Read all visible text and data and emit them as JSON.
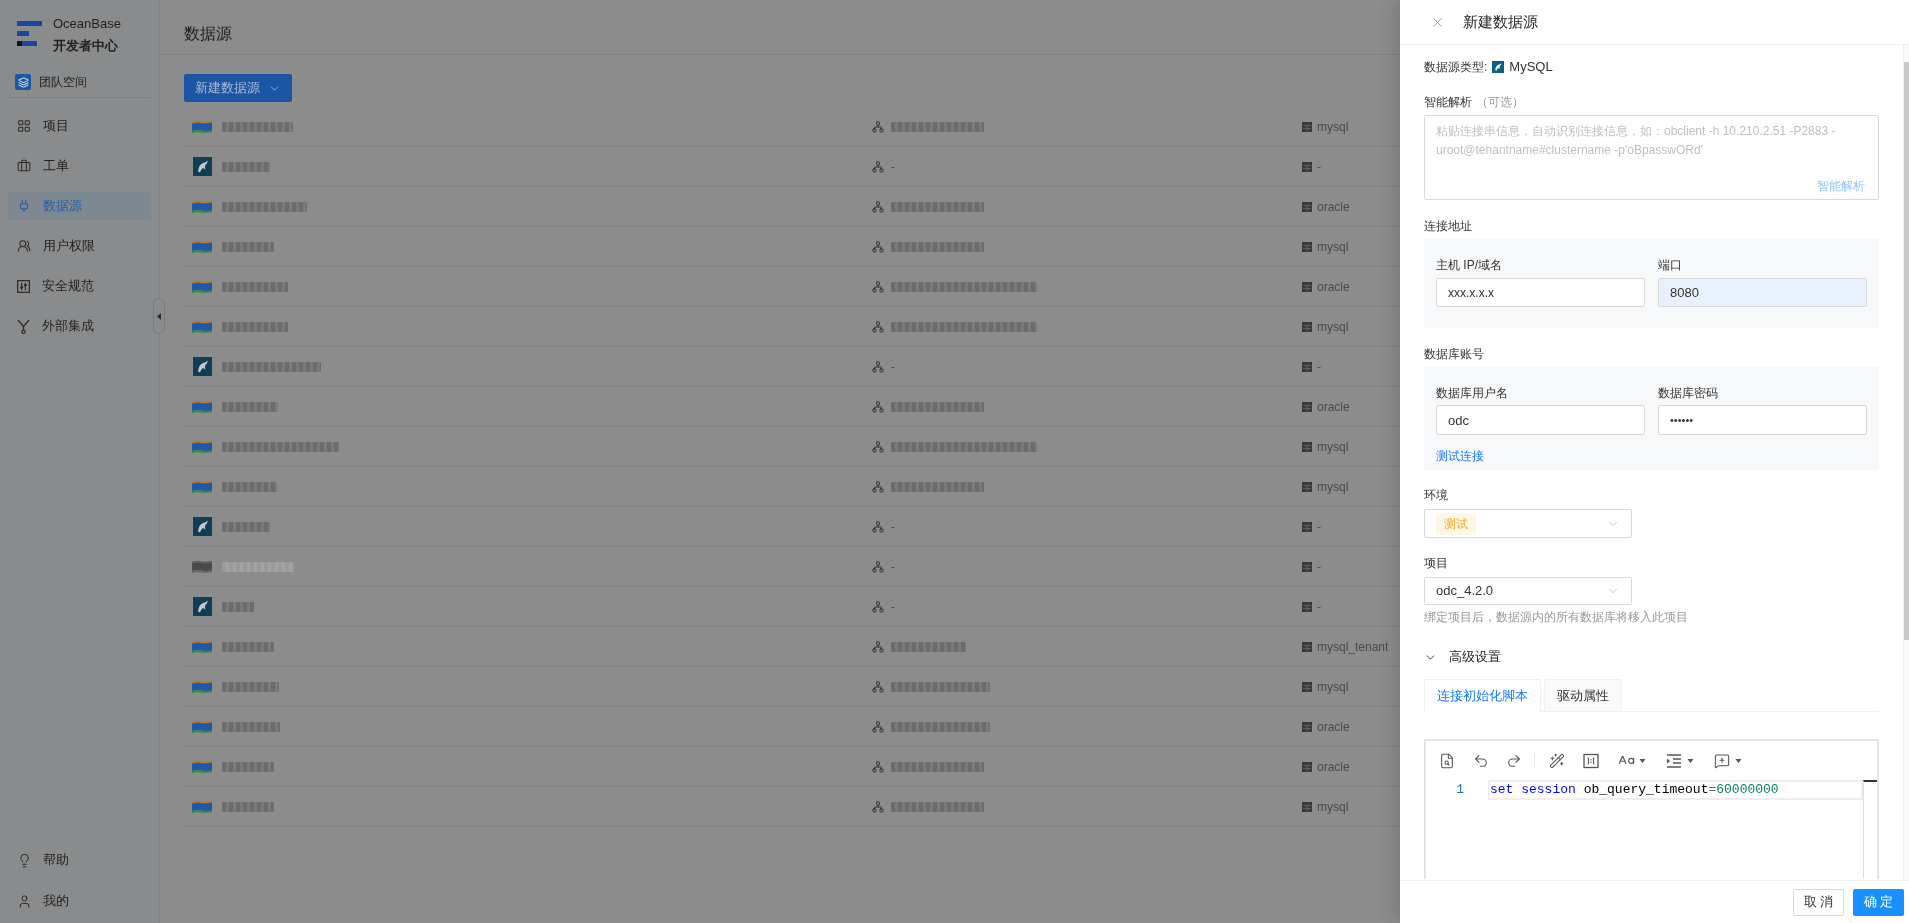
{
  "sidebar": {
    "brand": {
      "name": "OceanBase",
      "subtitle": "开发者中心"
    },
    "workspace": "团队空间",
    "nav": [
      {
        "label": "项目",
        "selected": false
      },
      {
        "label": "工单",
        "selected": false
      },
      {
        "label": "数据源",
        "selected": true
      },
      {
        "label": "用户权限",
        "selected": false
      },
      {
        "label": "安全规范",
        "selected": false
      },
      {
        "label": "外部集成",
        "selected": false
      }
    ],
    "footer": [
      {
        "label": "帮助"
      },
      {
        "label": "我的"
      }
    ]
  },
  "page": {
    "title": "数据源",
    "new_button": "新建数据源",
    "rows": [
      {
        "kind": "oceanbase",
        "disabled": false,
        "name_redacted": true,
        "host_redacted": true,
        "type": "mysql"
      },
      {
        "kind": "mysql",
        "disabled": false,
        "name_redacted": true,
        "host_redacted": false,
        "host": "-",
        "type": "-"
      },
      {
        "kind": "oceanbase",
        "disabled": false,
        "name_redacted": true,
        "host_redacted": true,
        "type": "oracle"
      },
      {
        "kind": "oceanbase",
        "disabled": false,
        "name_redacted": true,
        "host_redacted": true,
        "type": "mysql"
      },
      {
        "kind": "oceanbase",
        "disabled": false,
        "name_redacted": true,
        "host_redacted": true,
        "type": "oracle"
      },
      {
        "kind": "oceanbase",
        "disabled": false,
        "name_redacted": true,
        "host_redacted": true,
        "type": "mysql"
      },
      {
        "kind": "mysql",
        "disabled": false,
        "name_redacted": true,
        "host_redacted": false,
        "host": "-",
        "type": "-"
      },
      {
        "kind": "oceanbase",
        "disabled": false,
        "name_redacted": true,
        "host_redacted": true,
        "type": "oracle"
      },
      {
        "kind": "oceanbase",
        "disabled": false,
        "name_redacted": true,
        "host_redacted": true,
        "type": "mysql"
      },
      {
        "kind": "oceanbase",
        "disabled": false,
        "name_redacted": true,
        "host_redacted": true,
        "type": "mysql"
      },
      {
        "kind": "mysql",
        "disabled": false,
        "name_redacted": true,
        "host_redacted": false,
        "host": "-",
        "type": "-"
      },
      {
        "kind": "oceanbase",
        "disabled": true,
        "name_redacted": true,
        "host_redacted": false,
        "host": "-",
        "type": "-"
      },
      {
        "kind": "mysql",
        "disabled": false,
        "name_redacted": true,
        "host_redacted": false,
        "host": "-",
        "type": "-"
      },
      {
        "kind": "oceanbase",
        "disabled": false,
        "name_redacted": true,
        "host_redacted": true,
        "type": "mysql_tenant"
      },
      {
        "kind": "oceanbase",
        "disabled": false,
        "name_redacted": true,
        "host_redacted": true,
        "type": "mysql"
      },
      {
        "kind": "oceanbase",
        "disabled": false,
        "name_redacted": true,
        "host_redacted": true,
        "type": "oracle"
      },
      {
        "kind": "oceanbase",
        "disabled": false,
        "name_redacted": true,
        "host_redacted": true,
        "type": "oracle"
      },
      {
        "kind": "oceanbase",
        "disabled": false,
        "name_redacted": true,
        "host_redacted": true,
        "type": "mysql"
      }
    ]
  },
  "drawer": {
    "title": "新建数据源",
    "type": {
      "label": "数据源类型:",
      "value": "MySQL"
    },
    "smart_parse": {
      "label": "智能解析",
      "hint": "（可选）",
      "placeholder": "粘贴连接串信息，自动识别连接信息，如：obclient -h 10.210.2.51 -P2883 -uroot@tenantname#clustername -p'oBpasswORd'",
      "action": "智能解析"
    },
    "address": {
      "label": "连接地址",
      "host": {
        "label": "主机 IP/域名",
        "value": "xxx.x.x.x"
      },
      "port": {
        "label": "端口",
        "value": "8080",
        "autofilled": true
      }
    },
    "account": {
      "label": "数据库账号",
      "username": {
        "label": "数据库用户名",
        "value": "odc"
      },
      "password": {
        "label": "数据库密码",
        "value": "••••••"
      },
      "test_link": "测试连接"
    },
    "environment": {
      "label": "环境",
      "tag": "测试"
    },
    "project": {
      "label": "项目",
      "value": "odc_4.2.0",
      "help": "绑定项目后，数据源内的所有数据库将移入此项目"
    },
    "advanced": {
      "label": "高级设置",
      "expanded": true,
      "tabs": [
        {
          "label": "连接初始化脚本",
          "selected": true
        },
        {
          "label": "驱动属性",
          "selected": false
        }
      ],
      "editor": {
        "lines": [
          {
            "number": "1",
            "tokens": [
              {
                "text": "set session ",
                "kind": "keyword"
              },
              {
                "text": "ob_query_timeout",
                "kind": "identifier"
              },
              {
                "text": "=",
                "kind": "operator"
              },
              {
                "text": "60000000",
                "kind": "number"
              }
            ]
          }
        ]
      }
    },
    "buttons": [
      {
        "label": "取 消",
        "kind": "default"
      },
      {
        "label": "确 定",
        "kind": "primary"
      }
    ]
  }
}
